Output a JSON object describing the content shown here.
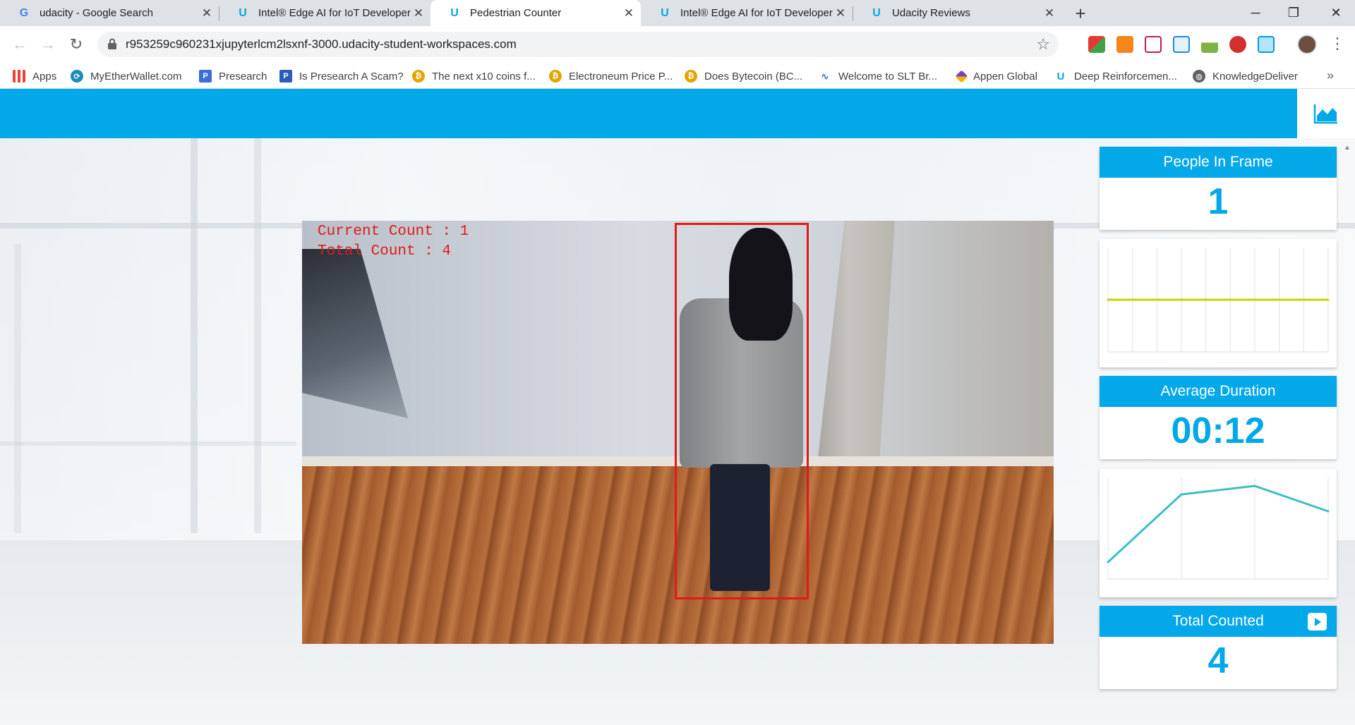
{
  "browser": {
    "tabs": [
      {
        "title": "udacity - Google Search",
        "favicon": "google-icon",
        "active": false
      },
      {
        "title": "Intel® Edge AI for IoT Developers",
        "favicon": "udacity-icon",
        "active": false
      },
      {
        "title": "Pedestrian Counter",
        "favicon": "udacity-icon",
        "active": true
      },
      {
        "title": "Intel® Edge AI for IoT Developers",
        "favicon": "udacity-icon",
        "active": false
      },
      {
        "title": "Udacity Reviews",
        "favicon": "udacity-icon",
        "active": false
      }
    ],
    "url": "r953259c960231xjupyterlcm2lsxnf-3000.udacity-student-workspaces.com",
    "bookmarks": [
      {
        "label": "Apps",
        "icon": "apps-grid-icon",
        "color": "#ea4335"
      },
      {
        "label": "MyEtherWallet.com",
        "icon": "myetherwallet-icon",
        "color": "#1a8cba"
      },
      {
        "label": "Presearch",
        "icon": "presearch-icon",
        "color": "#3b6fd8"
      },
      {
        "label": "Is Presearch A Scam?",
        "icon": "presearch-icon",
        "color": "#2b5cb8"
      },
      {
        "label": "The next x10 coins f...",
        "icon": "bitcoin-icon",
        "color": "#e2a400"
      },
      {
        "label": "Electroneum Price P...",
        "icon": "bitcoin-icon",
        "color": "#e2a400"
      },
      {
        "label": "Does Bytecoin (BC...",
        "icon": "bitcoin-icon",
        "color": "#e2a400"
      },
      {
        "label": "Welcome to SLT Br...",
        "icon": "slt-icon",
        "color": "#1a73e8"
      },
      {
        "label": "Appen Global",
        "icon": "appen-icon",
        "color": "#7b3fbf"
      },
      {
        "label": "Deep Reinforcemen...",
        "icon": "udacity-icon",
        "color": "#02a8e8"
      },
      {
        "label": "KnowledgeDeliver",
        "icon": "globe-icon",
        "color": "#5f6368"
      }
    ]
  },
  "video": {
    "current_count_text": "Current Count : 1",
    "total_count_text": "Total Count : 4"
  },
  "cards": {
    "people_in_frame": {
      "title": "People In Frame",
      "value": "1"
    },
    "average_duration": {
      "title": "Average Duration",
      "value": "00:12"
    },
    "total_counted": {
      "title": "Total Counted",
      "value": "4"
    }
  },
  "colors": {
    "brand": "#02a8e8",
    "people_line": "#c4d400",
    "duration_line": "#3cbfc4",
    "bbox": "#e01b1b"
  },
  "chart_data": [
    {
      "type": "line",
      "name": "people-in-frame-history",
      "x": [
        0,
        1,
        2,
        3,
        4,
        5,
        6,
        7,
        8,
        9
      ],
      "values": [
        1,
        1,
        1,
        1,
        1,
        1,
        1,
        1,
        1,
        1
      ],
      "ylim": [
        0,
        2
      ],
      "grid": true
    },
    {
      "type": "line",
      "name": "average-duration-history",
      "x": [
        0,
        1,
        2,
        3
      ],
      "values": [
        2,
        10,
        11,
        8
      ],
      "ylim": [
        0,
        12
      ],
      "grid": true
    }
  ]
}
